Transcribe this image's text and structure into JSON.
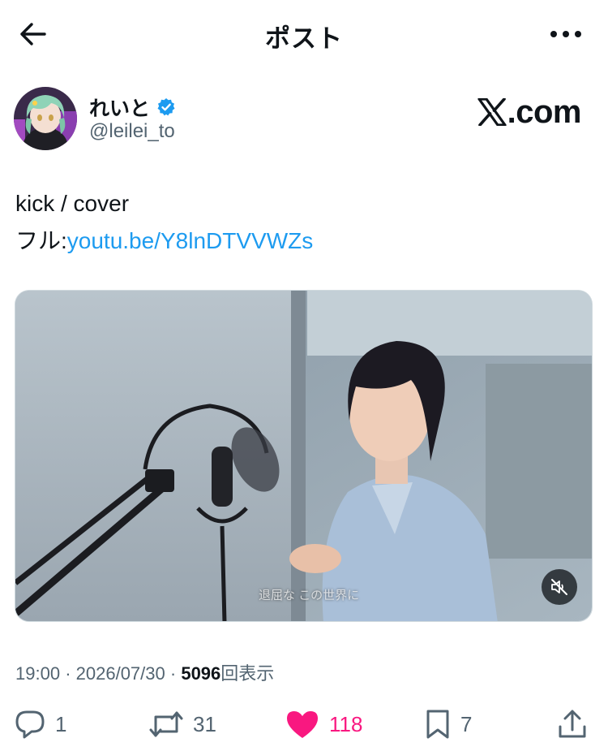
{
  "header": {
    "title": "ポスト",
    "back_icon": "arrow-left-icon",
    "more_icon": "more-dots-icon"
  },
  "author": {
    "display_name": "れいと",
    "handle": "@leilei_to",
    "verified": true,
    "verified_color": "#1d9bf0"
  },
  "brand": {
    "logo_text": ".com",
    "logo_icon": "x-logo-icon"
  },
  "post": {
    "line1": "kick / cover",
    "line2_prefix": "フル:",
    "link_text": "youtu.be/Y8lnDTVVWZs",
    "link_color": "#1d9bf0"
  },
  "media": {
    "subtitle": "退屈な この世界に",
    "mute_icon": "muted-speaker-icon"
  },
  "meta": {
    "time": "19:00",
    "separator": "·",
    "date": "2026/07/30",
    "views_count": "5096",
    "views_label": "回表示"
  },
  "actions": {
    "reply": {
      "icon": "reply-icon",
      "count": "1"
    },
    "repost": {
      "icon": "repost-icon",
      "count": "31"
    },
    "like": {
      "icon": "heart-filled-icon",
      "count": "118",
      "color": "#f91880"
    },
    "bookmark": {
      "icon": "bookmark-icon",
      "count": "7"
    },
    "share": {
      "icon": "share-icon"
    }
  }
}
